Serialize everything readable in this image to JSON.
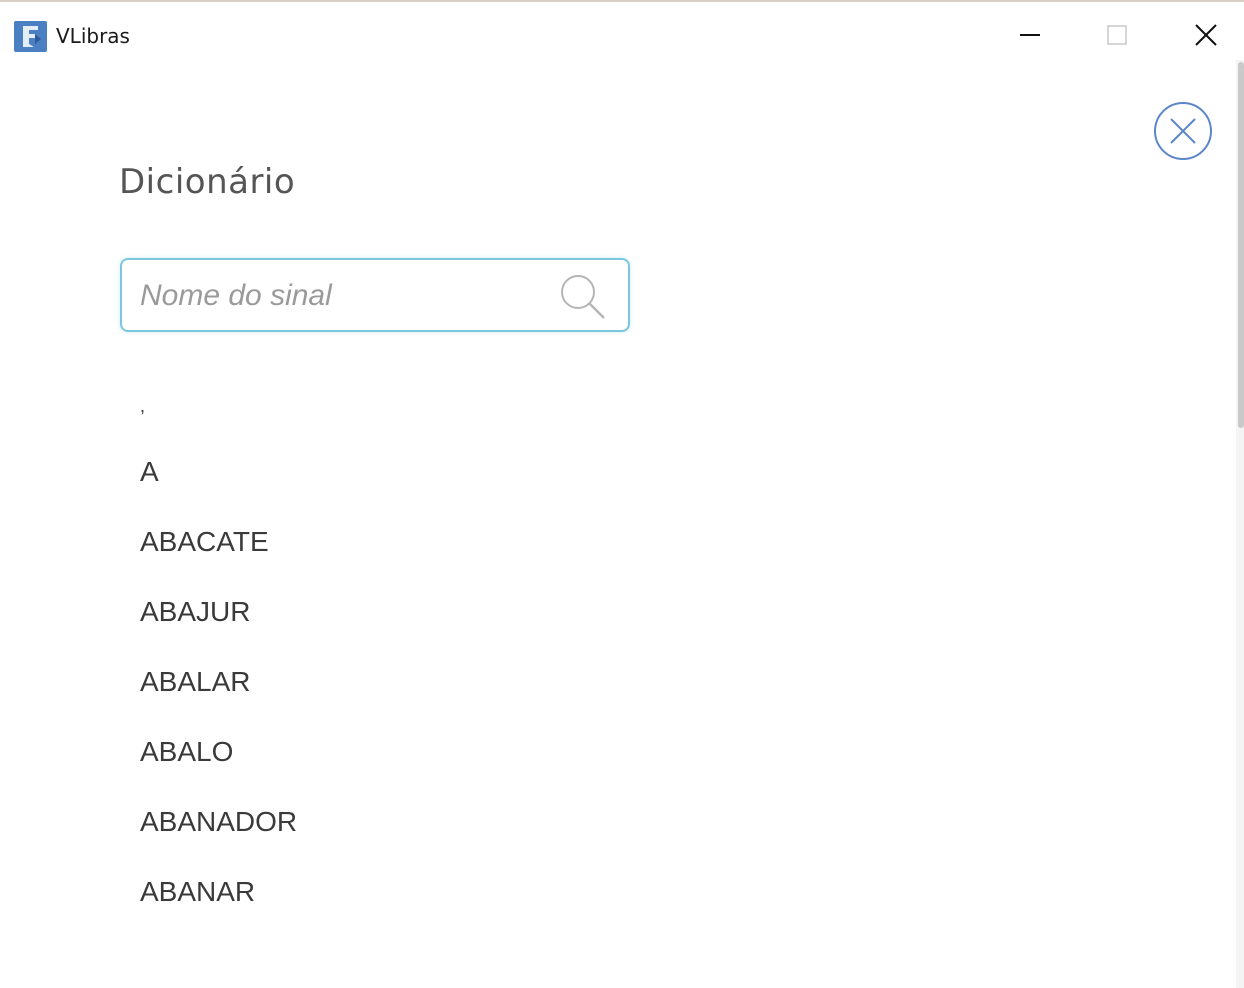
{
  "window": {
    "title": "VLibras",
    "icon": "vlibras-logo-icon",
    "controls": [
      "minimize-icon",
      "maximize-icon",
      "close-icon"
    ]
  },
  "dictionary": {
    "title": "Dicionário",
    "close_icon": "circle-close-icon",
    "search": {
      "placeholder": "Nome do sinal",
      "value": "",
      "icon": "search-icon"
    },
    "words": [
      ",",
      "A",
      "ABACATE",
      "ABAJUR",
      "ABALAR",
      "ABALO",
      "ABANADOR",
      "ABANAR"
    ]
  },
  "colors": {
    "accent": "#7cc7dd",
    "icon_blue": "#4a7fc1",
    "text": "#3a3a3a",
    "title": "#555555"
  }
}
